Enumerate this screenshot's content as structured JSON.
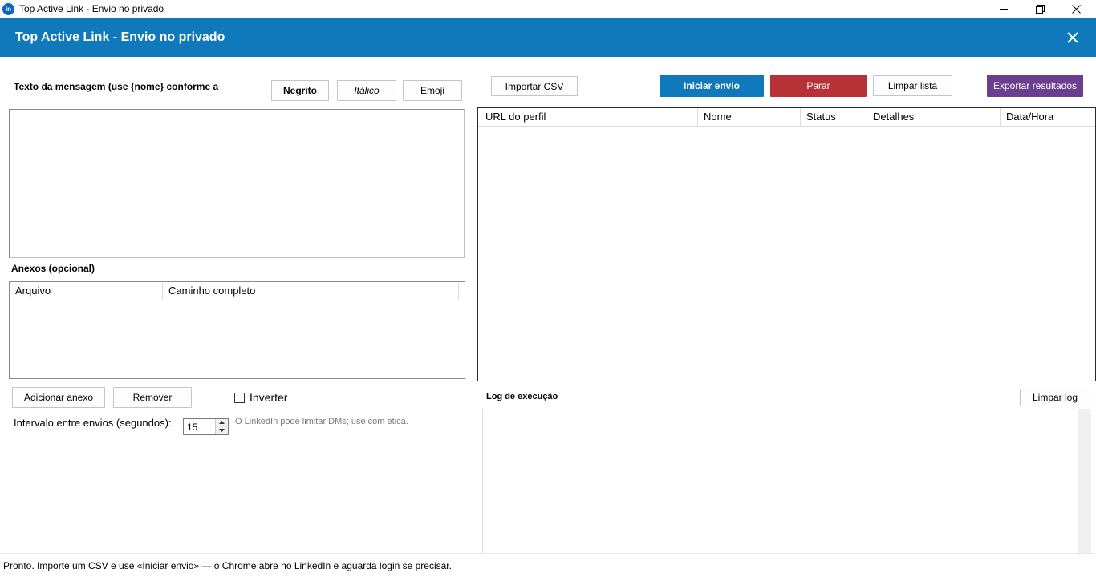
{
  "window": {
    "logo_text": "in",
    "title": "Top Active Link - Envio no privado"
  },
  "header": {
    "title": "Top Active Link - Envio no privado"
  },
  "left": {
    "message_label": "Texto da mensagem (use {nome} conforme a",
    "bold_button": "Negrito",
    "italic_button": "Itálico",
    "emoji_button": "Emoji",
    "message_value": "",
    "attachments_label": "Anexos (opcional)",
    "attachments_columns": [
      "Arquivo",
      "Caminho completo"
    ],
    "add_attachment_button": "Adicionar anexo",
    "remove_button": "Remover",
    "invert_label": "Inverter",
    "interval_label": "Intervalo entre envios (segundos):",
    "interval_value": "15",
    "hint": "O LinkedIn pode limitar DMs; use com ética."
  },
  "toolbar": {
    "import_csv": "Importar CSV",
    "start": "Iniciar envio",
    "stop": "Parar",
    "clear_list": "Limpar lista",
    "export": "Exportar resultados"
  },
  "table": {
    "columns": [
      "URL do perfil",
      "Nome",
      "Status",
      "Detalhes",
      "Data/Hora"
    ]
  },
  "log": {
    "label": "Log de execução",
    "clear_button": "Limpar log"
  },
  "status": {
    "text": "Pronto. Importe um CSV e use «Iniciar envio» — o Chrome abre no LinkedIn e aguarda login se precisar."
  },
  "colors": {
    "header_blue": "#0f79bc",
    "start_blue": "#0f79bc",
    "stop_red": "#b73237",
    "export_purple": "#6a3f8f"
  }
}
